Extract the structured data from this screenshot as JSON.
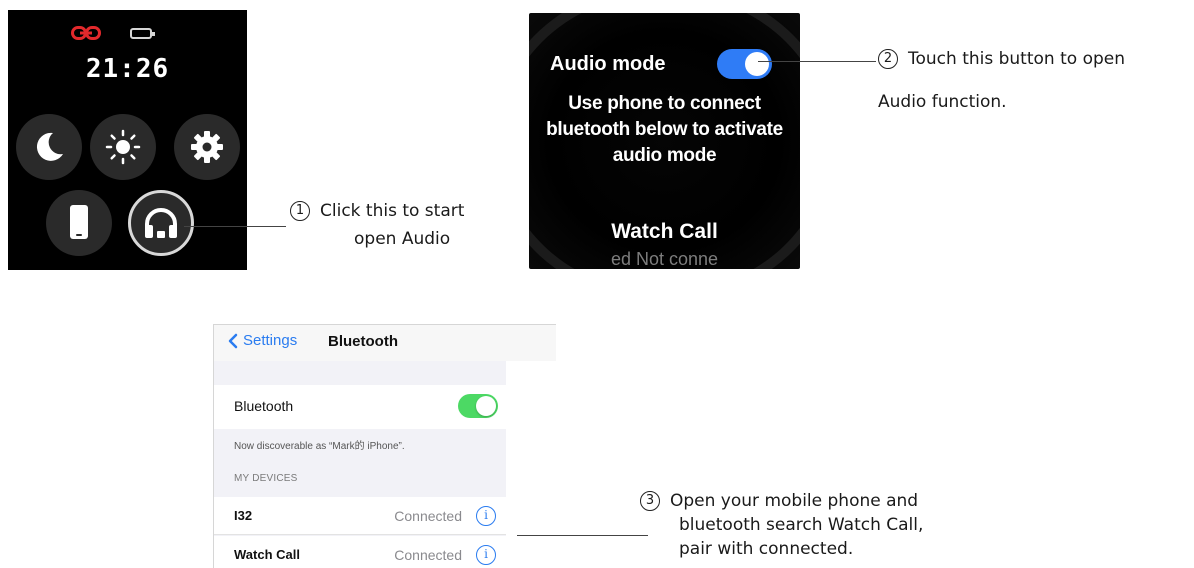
{
  "watch_controls": {
    "time": "21:26",
    "buttons": [
      {
        "name": "do-not-disturb",
        "icon": "moon-icon"
      },
      {
        "name": "brightness",
        "icon": "sun-icon"
      },
      {
        "name": "settings",
        "icon": "gear-icon"
      },
      {
        "name": "find-phone",
        "icon": "phone-icon"
      },
      {
        "name": "audio",
        "icon": "headphones-icon"
      }
    ],
    "colors": {
      "link_icon": "#e3292c",
      "button_bg": "#2a2a2a"
    }
  },
  "watch_audio": {
    "audio_label": "Audio mode",
    "toggle_on": true,
    "instruction_lines": [
      "Use phone to connect",
      "bluetooth below to activate",
      "audio mode"
    ],
    "call_title": "Watch Call",
    "call_status": "ed Not conne",
    "colors": {
      "toggle": "#2f7cf6"
    }
  },
  "annotations": {
    "step1": {
      "num": "1",
      "line1": "Click this to start",
      "line2": "open Audio"
    },
    "step2": {
      "num": "2",
      "line1": "Touch this button to open",
      "line2": "Audio function."
    },
    "step3": {
      "num": "3",
      "line1": "Open your mobile phone and",
      "line2": "bluetooth search Watch Call,",
      "line3": "pair with connected."
    }
  },
  "phone_settings": {
    "back_label": "Settings",
    "title": "Bluetooth",
    "bluetooth_label": "Bluetooth",
    "bluetooth_on": true,
    "discoverable": "Now discoverable as “Mark的 iPhone”.",
    "section_header": "MY DEVICES",
    "devices": [
      {
        "name": "I32",
        "status": "Connected"
      },
      {
        "name": "Watch Call",
        "status": "Connected"
      }
    ],
    "info_glyph": "i",
    "colors": {
      "accent": "#2a7cf0",
      "switch": "#4cd964"
    }
  }
}
